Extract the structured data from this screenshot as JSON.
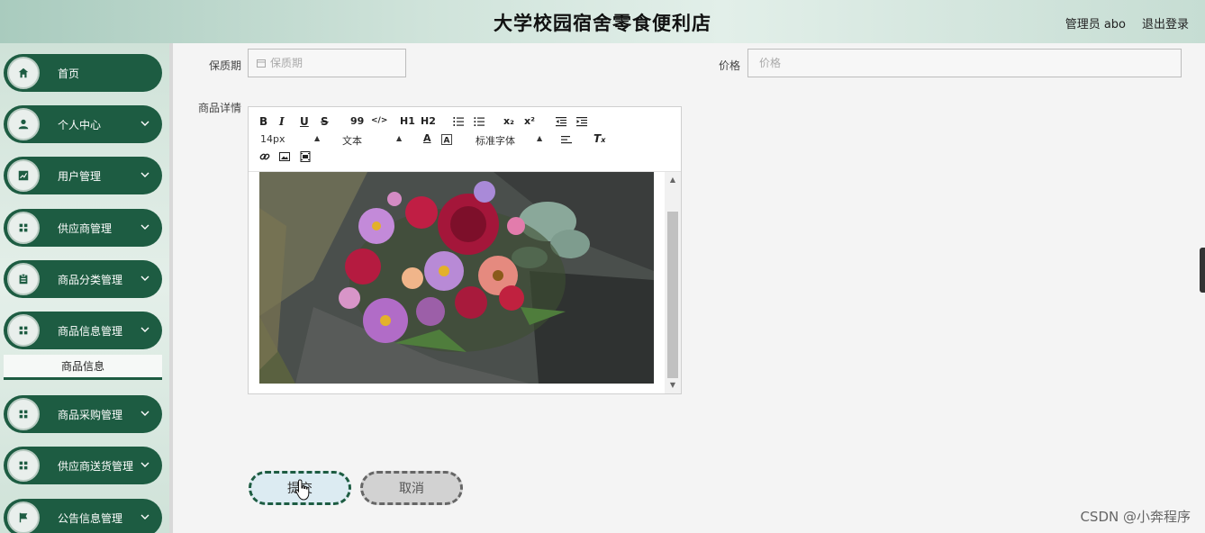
{
  "header": {
    "title": "大学校园宿舍零食便利店",
    "user": "管理员 abo",
    "logout": "退出登录"
  },
  "sidebar": {
    "items": [
      {
        "label": "首页",
        "icon": "home-icon",
        "expandable": false
      },
      {
        "label": "个人中心",
        "icon": "user-icon",
        "expandable": true
      },
      {
        "label": "用户管理",
        "icon": "chart-icon",
        "expandable": true
      },
      {
        "label": "供应商管理",
        "icon": "grid-icon",
        "expandable": true
      },
      {
        "label": "商品分类管理",
        "icon": "clipboard-icon",
        "expandable": true
      },
      {
        "label": "商品信息管理",
        "icon": "grid-icon",
        "expandable": true
      },
      {
        "label": "商品采购管理",
        "icon": "grid-icon",
        "expandable": true
      },
      {
        "label": "供应商送货管理",
        "icon": "grid-icon",
        "expandable": true
      },
      {
        "label": "公告信息管理",
        "icon": "flag-icon",
        "expandable": true
      }
    ],
    "active_sub": "商品信息"
  },
  "form": {
    "shelf_life_label": "保质期",
    "shelf_life_placeholder": "保质期",
    "price_label": "价格",
    "price_placeholder": "价格",
    "detail_label": "商品详情"
  },
  "editor": {
    "font_size": "14px",
    "text_type": "文本",
    "font_family": "标准字体",
    "buttons": {
      "bold": "B",
      "italic": "I",
      "underline": "U",
      "strike": "S",
      "quote": "99",
      "code": "</>",
      "h1": "H1",
      "h2": "H2",
      "sub": "x₂",
      "sup": "x²"
    }
  },
  "actions": {
    "submit": "提交",
    "cancel": "取消"
  },
  "watermark": "CSDN @小奔程序",
  "colors": {
    "accent": "#1d5c42",
    "header_bg": "#cfe3da"
  }
}
